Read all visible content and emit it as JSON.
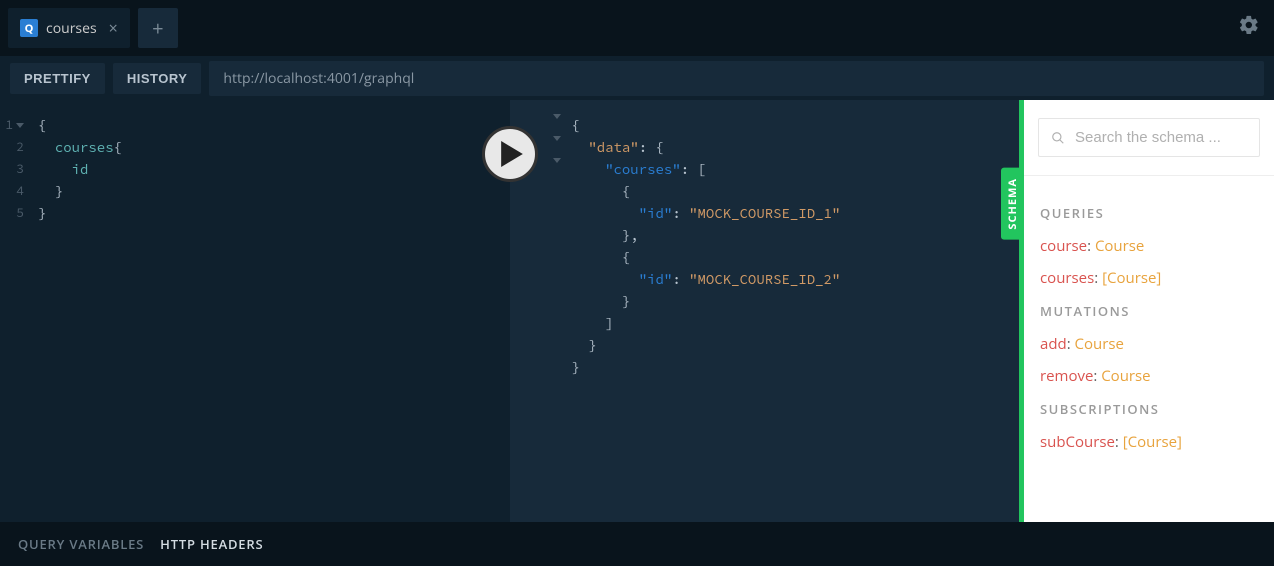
{
  "tab": {
    "icon": "Q",
    "name": "courses"
  },
  "toolbar": {
    "prettify": "PRETTIFY",
    "history": "HISTORY",
    "endpoint": "http://localhost:4001/graphql"
  },
  "query": {
    "lines": [
      "1",
      "2",
      "3",
      "4",
      "5"
    ],
    "l1_open": "{",
    "l2_field": "courses",
    "l2_brace": "{",
    "l3_field": "id",
    "l4_close": "}",
    "l5_close": "}"
  },
  "result": {
    "open": "{",
    "data_key": "\"data\"",
    "data_colon": ": {",
    "courses_key": "\"courses\"",
    "courses_colon": ": [",
    "obj_open": "{",
    "id_key": "\"id\"",
    "id_colon": ": ",
    "id1": "\"MOCK_COURSE_ID_1\"",
    "obj_close_comma": "},",
    "id2": "\"MOCK_COURSE_ID_2\"",
    "obj_close": "}",
    "arr_close": "]",
    "close": "}"
  },
  "schema_tab": "SCHEMA",
  "schema": {
    "search_placeholder": "Search the schema ...",
    "sections": {
      "queries": "QUERIES",
      "mutations": "MUTATIONS",
      "subscriptions": "SUBSCRIPTIONS"
    },
    "queries": [
      {
        "name": "course",
        "type": "Course"
      },
      {
        "name": "courses",
        "type": "[Course]"
      }
    ],
    "mutations": [
      {
        "name": "add",
        "type": "Course"
      },
      {
        "name": "remove",
        "type": "Course"
      }
    ],
    "subscriptions": [
      {
        "name": "subCourse",
        "type": "[Course]"
      }
    ]
  },
  "bottom": {
    "vars": "QUERY VARIABLES",
    "headers": "HTTP HEADERS"
  }
}
